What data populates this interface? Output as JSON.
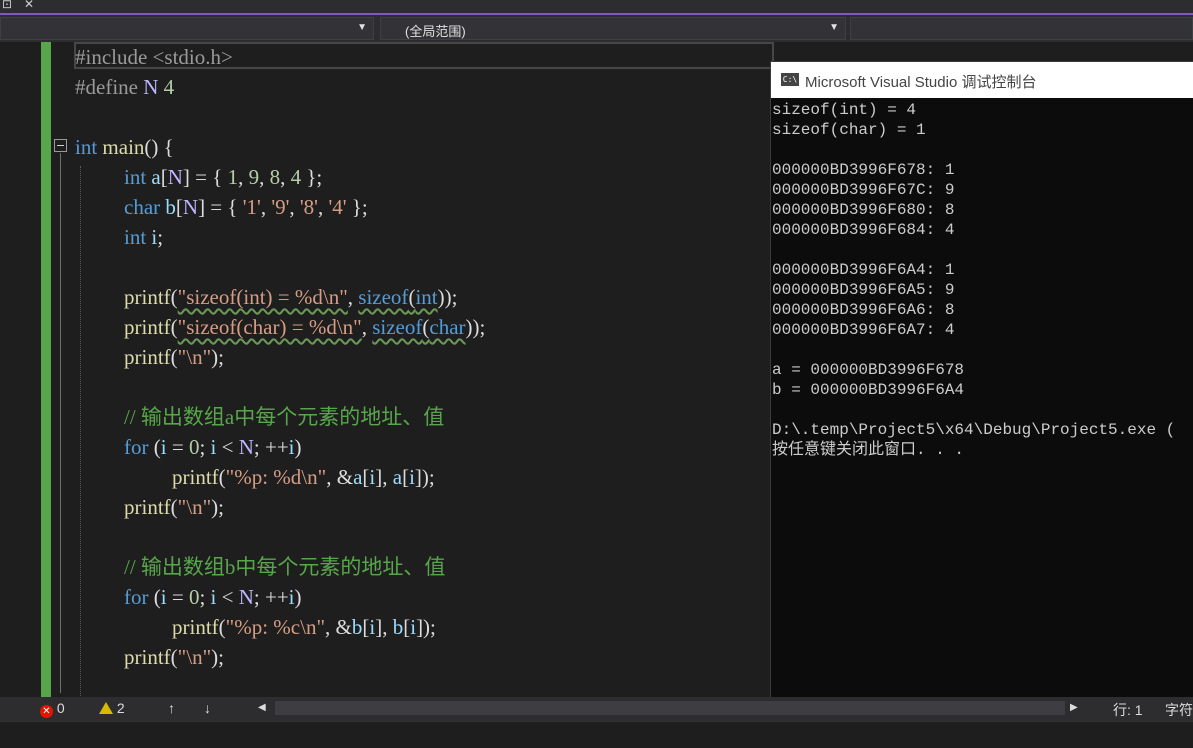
{
  "navbar": {
    "scope_dropdown": "(全局范围)"
  },
  "editor": {
    "code": {
      "l1": "#include <stdio.h>",
      "l2a": "#define ",
      "l2b": "N",
      "l2c": " 4",
      "l4a": "int",
      "l4b": " main",
      "l4c": "() {",
      "l5a": "int",
      "l5b": " a",
      "l5c": "[",
      "l5d": "N",
      "l5e": "] = { ",
      "l5f": "1",
      "l5g": ", ",
      "l5h": "9",
      "l5i": ", ",
      "l5j": "8",
      "l5k": ", ",
      "l5l": "4",
      "l5m": " };",
      "l6a": "char",
      "l6b": " b",
      "l6c": "[",
      "l6d": "N",
      "l6e": "] = { ",
      "l6f": "'1'",
      "l6g": ", ",
      "l6h": "'9'",
      "l6i": ", ",
      "l6j": "'8'",
      "l6k": ", ",
      "l6l": "'4'",
      "l6m": " };",
      "l7a": "int",
      "l7b": " i",
      "l7c": ";",
      "l9a": "printf",
      "l9b": "(",
      "l9c": "\"sizeof(int) = %d\\n\"",
      "l9d": ", ",
      "l9e": "sizeof",
      "l9f": "(",
      "l9g": "int",
      "l9h": "));",
      "l10a": "printf",
      "l10b": "(",
      "l10c": "\"sizeof(char) = %d\\n\"",
      "l10d": ", ",
      "l10e": "sizeof",
      "l10f": "(",
      "l10g": "char",
      "l10h": "));",
      "l11a": "printf",
      "l11b": "(",
      "l11c": "\"\\n\"",
      "l11d": ");",
      "l13": "// 输出数组a中每个元素的地址、值",
      "l14a": "for",
      "l14b": " (",
      "l14c": "i",
      "l14d": " = ",
      "l14e": "0",
      "l14f": "; ",
      "l14g": "i",
      "l14h": " < ",
      "l14i": "N",
      "l14j": "; ++",
      "l14k": "i",
      "l14l": ")",
      "l15a": "printf",
      "l15b": "(",
      "l15c": "\"%p: %d\\n\"",
      "l15d": ", &",
      "l15e": "a",
      "l15f": "[",
      "l15g": "i",
      "l15h": "], ",
      "l15i": "a",
      "l15j": "[",
      "l15k": "i",
      "l15l": "]);",
      "l16a": "printf",
      "l16b": "(",
      "l16c": "\"\\n\"",
      "l16d": ");",
      "l18": "// 输出数组b中每个元素的地址、值",
      "l19a": "for",
      "l19b": " (",
      "l19c": "i",
      "l19d": " = ",
      "l19e": "0",
      "l19f": "; ",
      "l19g": "i",
      "l19h": " < ",
      "l19i": "N",
      "l19j": "; ++",
      "l19k": "i",
      "l19l": ")",
      "l20a": "printf",
      "l20b": "(",
      "l20c": "\"%p: %c\\n\"",
      "l20d": ", &",
      "l20e": "b",
      "l20f": "[",
      "l20g": "i",
      "l20h": "], ",
      "l20i": "b",
      "l20j": "[",
      "l20k": "i",
      "l20l": "]);",
      "l21a": "printf",
      "l21b": "(",
      "l21c": "\"\\n\"",
      "l21d": ");"
    }
  },
  "console": {
    "title": "Microsoft Visual Studio 调试控制台",
    "lines": [
      "sizeof(int) = 4",
      "sizeof(char) = 1",
      "",
      "000000BD3996F678: 1",
      "000000BD3996F67C: 9",
      "000000BD3996F680: 8",
      "000000BD3996F684: 4",
      "",
      "000000BD3996F6A4: 1",
      "000000BD3996F6A5: 9",
      "000000BD3996F6A6: 8",
      "000000BD3996F6A7: 4",
      "",
      "a = 000000BD3996F678",
      "b = 000000BD3996F6A4",
      "",
      "D:\\.temp\\Project5\\x64\\Debug\\Project5.exe (",
      "按任意键关闭此窗口. . ."
    ]
  },
  "status": {
    "errors": "0",
    "warnings": "2",
    "line_label": "行: 1",
    "char_label": "字符"
  },
  "icons": {
    "error": "error-icon",
    "warning": "warning-icon",
    "up": "arrow-up-icon",
    "down": "arrow-down-icon"
  },
  "colors": {
    "change_bar": "#57a64a",
    "keyword": "#569cd6",
    "string": "#d69d85",
    "comment": "#57a64a",
    "function": "#dcdcaa",
    "variable": "#9cdcfe",
    "macro": "#beb7ff"
  }
}
